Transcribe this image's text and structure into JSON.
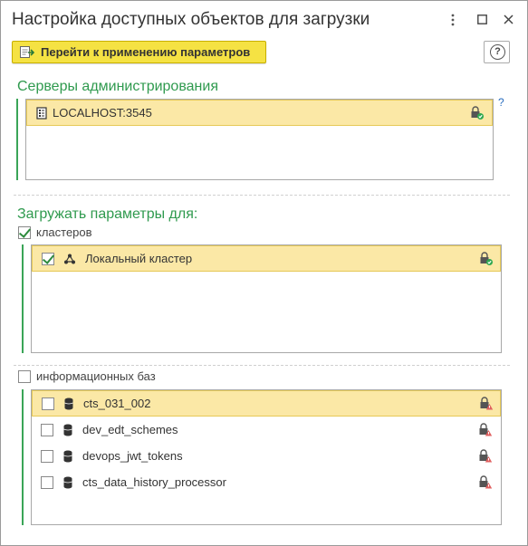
{
  "window": {
    "title": "Настройка доступных объектов для загрузки",
    "menu_icon": "vertical-dots-icon",
    "maximize_icon": "maximize-icon",
    "close_icon": "close-icon"
  },
  "toolbar": {
    "apply_label": "Перейти к применению параметров",
    "help_label": "?"
  },
  "servers": {
    "title": "Серверы администрирования",
    "help_hint": "?",
    "items": [
      {
        "label": "LOCALHOST:3545",
        "selected": true,
        "lock_status": "ok"
      }
    ]
  },
  "load_params": {
    "title": "Загружать параметры для:",
    "clusters": {
      "label": "кластеров",
      "checked": true,
      "items": [
        {
          "label": "Локальный кластер",
          "checked": true,
          "selected": true,
          "lock_status": "ok"
        }
      ]
    },
    "infobases": {
      "label": "информационных баз",
      "checked": false,
      "items": [
        {
          "label": "cts_031_002",
          "checked": false,
          "selected": true,
          "lock_status": "warning"
        },
        {
          "label": "dev_edt_schemes",
          "checked": false,
          "selected": false,
          "lock_status": "warning"
        },
        {
          "label": "devops_jwt_tokens",
          "checked": false,
          "selected": false,
          "lock_status": "warning"
        },
        {
          "label": "cts_data_history_processor",
          "checked": false,
          "selected": false,
          "lock_status": "warning"
        }
      ]
    }
  },
  "colors": {
    "accent_green": "#2f9a4e",
    "button_yellow": "#f5e243",
    "row_selected": "#fbe8a6",
    "lock_ok": "#2fa84f",
    "lock_warning": "#e06060"
  }
}
